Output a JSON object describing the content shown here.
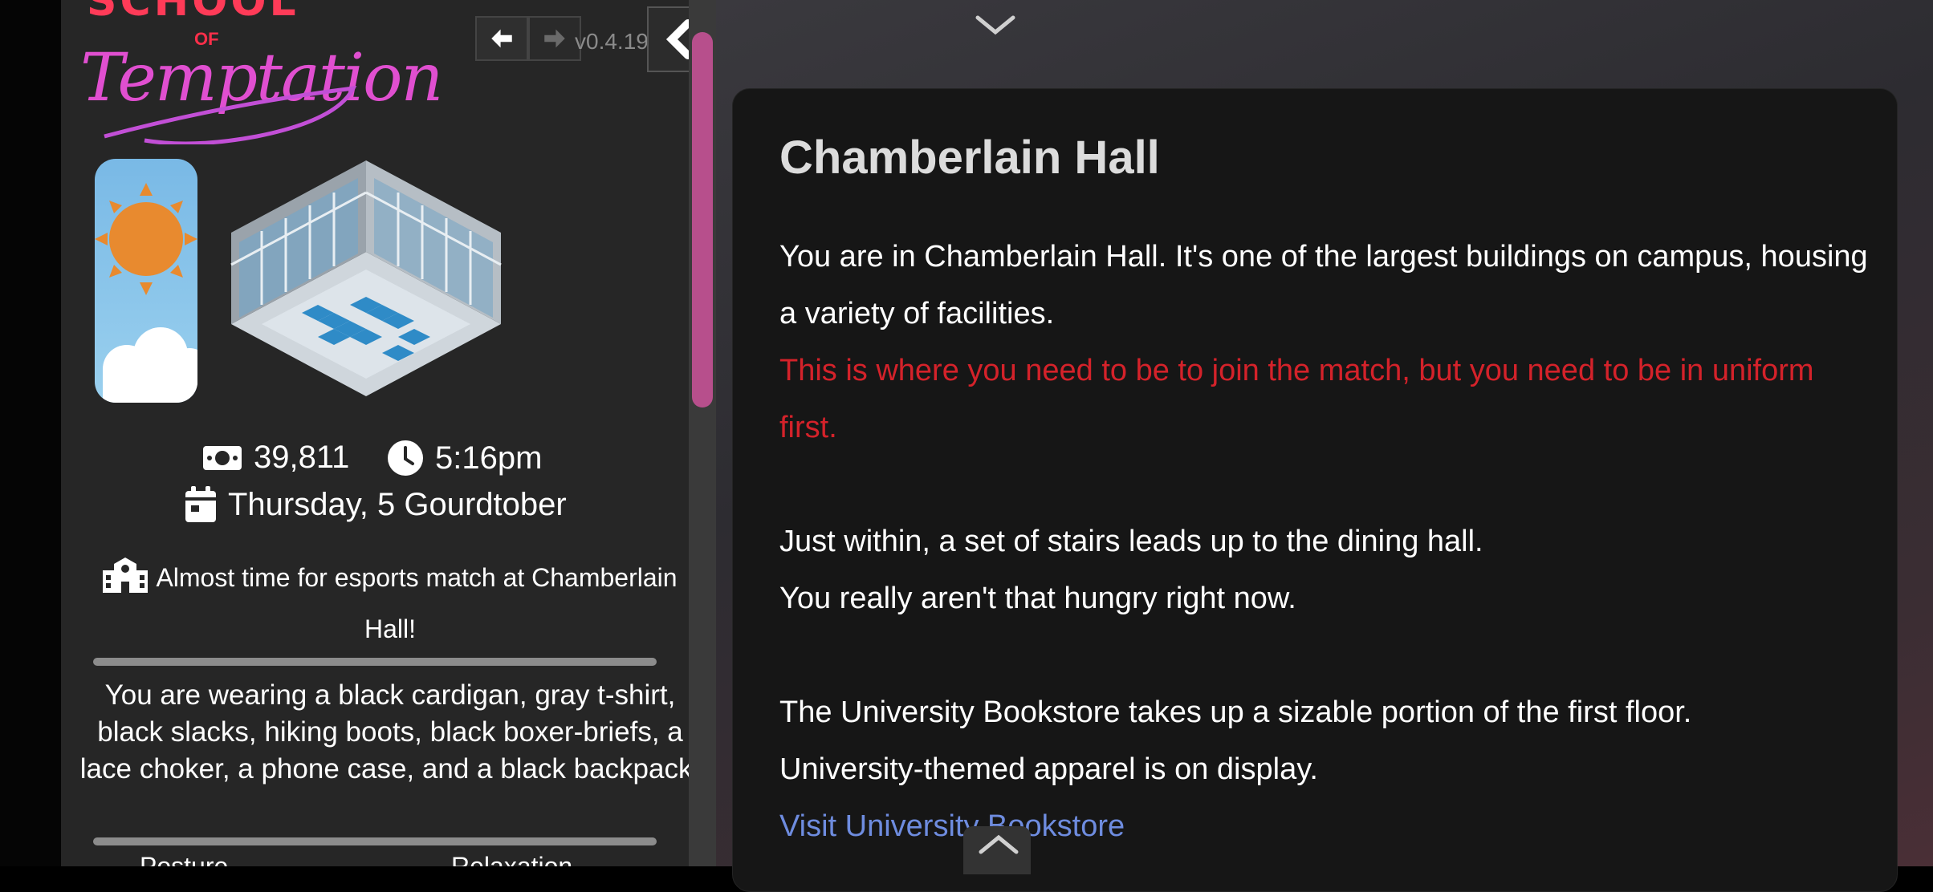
{
  "sidebar": {
    "logo": {
      "top_text": "SCHOOL",
      "of_text": "OF",
      "script_text": "Temptation"
    },
    "nav": {
      "back_icon": "arrow-left-icon",
      "forward_icon": "arrow-right-icon",
      "collapse_icon": "chevron-left-icon"
    },
    "version": "v0.4.19",
    "weather": {
      "icon": "sun-cloud-icon",
      "sun_color": "#e88a2f",
      "sky_color": "#7fbde8"
    },
    "location_image": {
      "icon": "building-isometric-icon"
    },
    "money": "39,811",
    "time": "5:16pm",
    "date": "Thursday, 5 Gourdtober",
    "notice": "Almost time for esports match at Chamberlain Hall!",
    "outfit": "You are wearing a black cardigan, gray t-shirt, black slacks, hiking boots, black boxer-briefs, a lace choker, a phone case, and a black backpack.",
    "stats_labels": [
      "Posture",
      "Relaxation"
    ]
  },
  "main": {
    "title": "Chamberlain Hall",
    "paragraphs": {
      "p1": "You are in Chamberlain Hall. It's one of the largest buildings on campus, housing a variety of facilities.",
      "warning": "This is where you need to be to join the match, but you need to be in uniform first.",
      "stairs_1": "Just within, a set of stairs leads up to the dining hall.",
      "stairs_2": "You really aren't that hungry right now.",
      "store_1": "The University Bookstore takes up a sizable portion of the first floor.",
      "store_2": "University-themed apparel is on display.",
      "link": "Visit University Bookstore"
    }
  },
  "colors": {
    "accent_pink": "#b74f8c",
    "warning_red": "#d4222a",
    "link_blue": "#6e8cdf"
  }
}
